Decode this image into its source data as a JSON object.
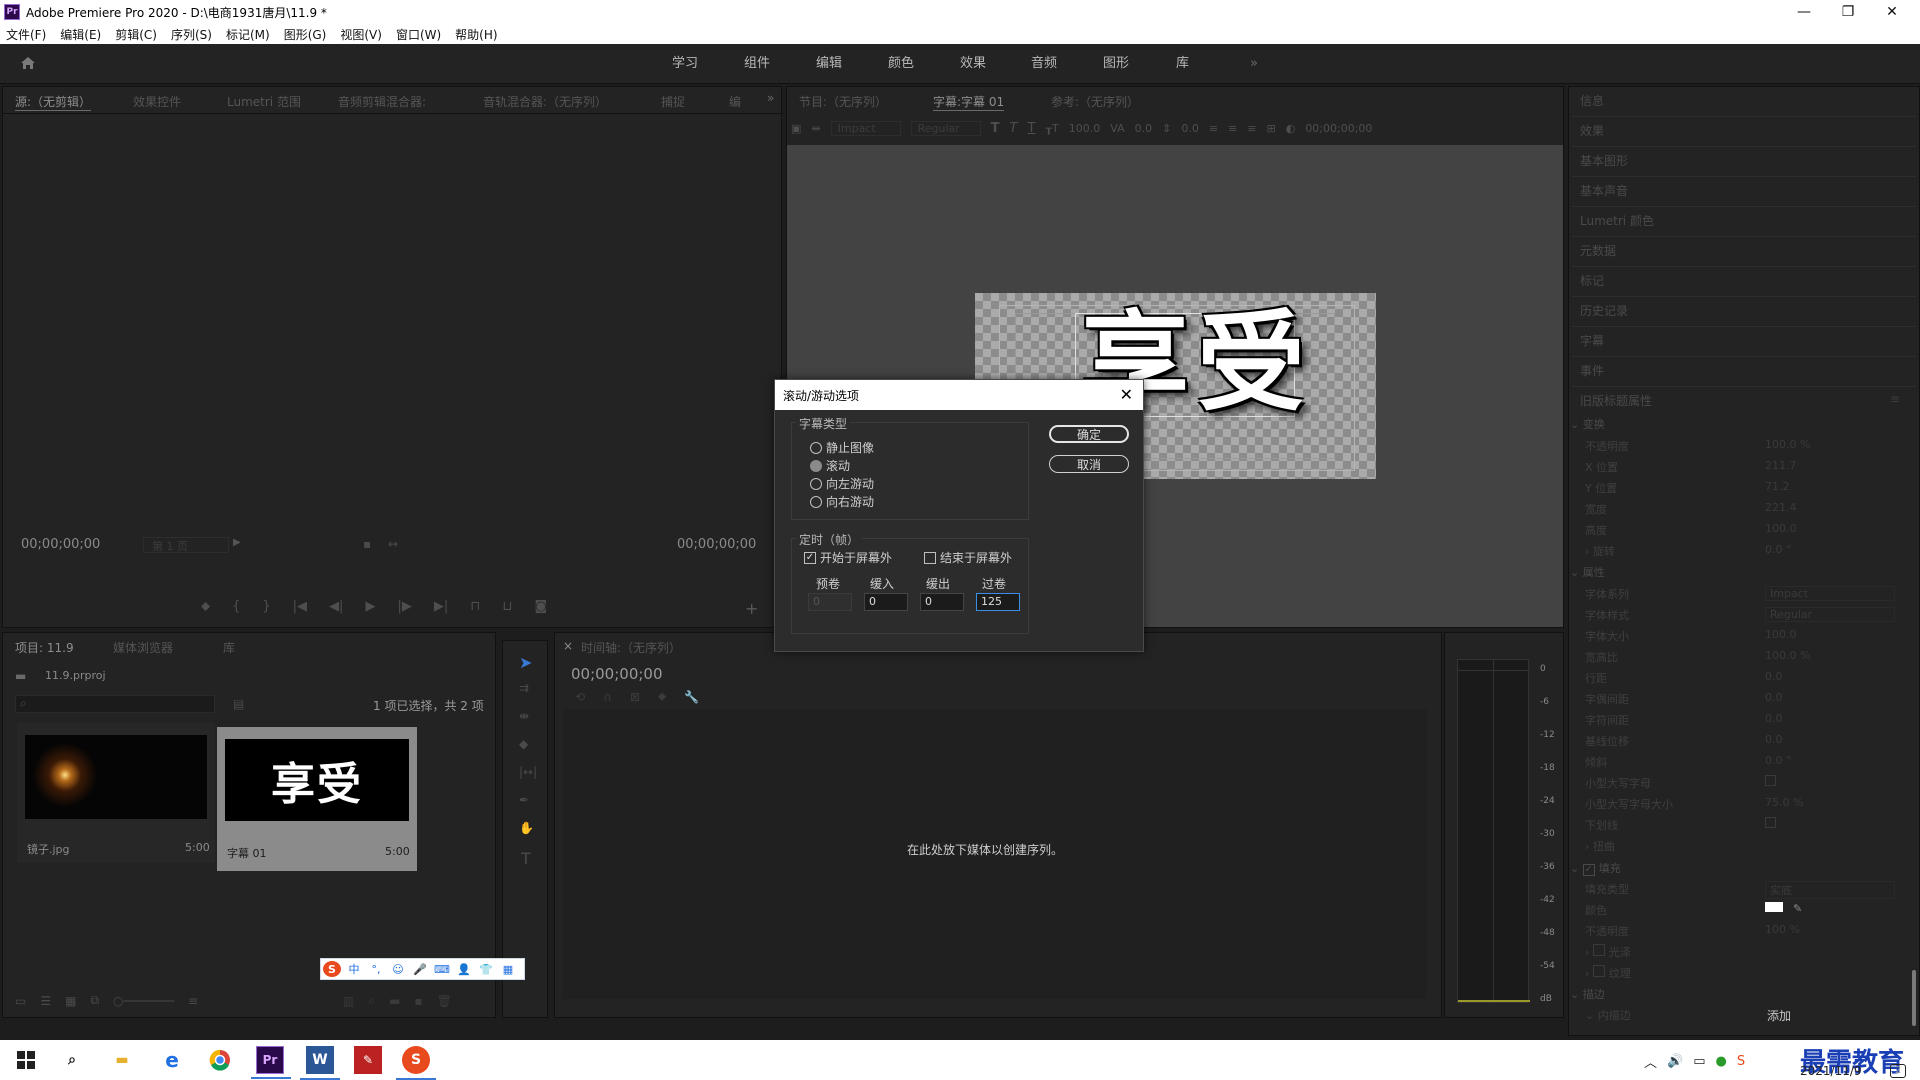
{
  "window": {
    "title": "Adobe Premiere Pro 2020 - D:\\电商1931唐月\\11.9  *",
    "app_icon": "Pr",
    "controls": [
      "minimize",
      "maximize",
      "close"
    ]
  },
  "menu": [
    "文件(F)",
    "编辑(E)",
    "剪辑(C)",
    "序列(S)",
    "标记(M)",
    "图形(G)",
    "视图(V)",
    "窗口(W)",
    "帮助(H)"
  ],
  "workspaces": {
    "tabs": [
      "学习",
      "组件",
      "编辑",
      "颜色",
      "效果",
      "音频",
      "图形",
      "库"
    ],
    "more": "»"
  },
  "source_panel": {
    "tabs": [
      "源:（无剪辑）",
      "效果控件",
      "Lumetri 范围",
      "音频剪辑混合器:",
      "音轨混合器:（无序列）",
      "捕捉",
      "编"
    ],
    "timecode_left": "00;00;00;00",
    "page": "第 1 页",
    "timecode_right": "00;00;00;00"
  },
  "program_panel": {
    "tabs": [
      "节目:（无序列）",
      "字幕:字幕 01",
      "参考:（无序列）"
    ],
    "font_family": "Impact",
    "font_style": "Regular",
    "size": "100.0",
    "kerning": "0.0",
    "leading": "0.0",
    "timecode": "00;00;00;00",
    "preview_text": "享受"
  },
  "right_panel": {
    "items": [
      "信息",
      "效果",
      "基本图形",
      "基本声音",
      "Lumetri 颜色",
      "元数据",
      "标记",
      "历史记录",
      "字幕",
      "事件"
    ],
    "section_title": "旧版标题属性",
    "transform_title": "变换",
    "transform": [
      {
        "label": "不透明度",
        "value": "100.0 %"
      },
      {
        "label": "X 位置",
        "value": "211.7"
      },
      {
        "label": "Y 位置",
        "value": "71.2"
      },
      {
        "label": "宽度",
        "value": "221.4"
      },
      {
        "label": "高度",
        "value": "100.0"
      },
      {
        "label": "旋转",
        "value": "0.0 °"
      }
    ],
    "props_title": "属性",
    "props": [
      {
        "label": "字体系列",
        "value": "Impact"
      },
      {
        "label": "字体样式",
        "value": "Regular"
      },
      {
        "label": "字体大小",
        "value": "100.0"
      },
      {
        "label": "宽高比",
        "value": "100.0 %"
      },
      {
        "label": "行距",
        "value": "0.0"
      },
      {
        "label": "字偶间距",
        "value": "0.0"
      },
      {
        "label": "字符间距",
        "value": "0.0"
      },
      {
        "label": "基线位移",
        "value": "0.0"
      },
      {
        "label": "倾斜",
        "value": "0.0 °"
      },
      {
        "label": "小型大写字母",
        "value": ""
      },
      {
        "label": "小型大写字母大小",
        "value": "75.0 %"
      },
      {
        "label": "下划线",
        "value": ""
      },
      {
        "label": "扭曲",
        "value": ""
      }
    ],
    "fill_title": "填充",
    "fill": [
      {
        "label": "填充类型",
        "value": "实底"
      },
      {
        "label": "颜色",
        "value": ""
      },
      {
        "label": "不透明度",
        "value": "100 %"
      },
      {
        "label": "光泽",
        "value": ""
      },
      {
        "label": "纹理",
        "value": ""
      }
    ],
    "stroke_title": "描边",
    "inner_stroke": "内描边",
    "add": "添加"
  },
  "project_panel": {
    "tabs": [
      "项目: 11.9",
      "媒体浏览器",
      "库"
    ],
    "file": "11.9.prproj",
    "selection": "1 项已选择，共 2 项",
    "items": [
      {
        "name": "镜子.jpg",
        "duration": "5:00"
      },
      {
        "name": "字幕 01",
        "duration": "5:00",
        "thumb_text": "享受"
      }
    ]
  },
  "timeline_panel": {
    "tab": "时间轴:（无序列）",
    "timecode": "00;00;00;00",
    "empty_hint": "在此处放下媒体以创建序列。"
  },
  "audio_meter": {
    "ticks": [
      "0",
      "-6",
      "-12",
      "-18",
      "-24",
      "-30",
      "-36",
      "-42",
      "-48",
      "-54",
      "dB"
    ]
  },
  "dialog": {
    "title": "滚动/游动选项",
    "type_group": "字幕类型",
    "types": [
      {
        "label": "静止图像",
        "selected": false
      },
      {
        "label": "滚动",
        "selected": true
      },
      {
        "label": "向左游动",
        "selected": false
      },
      {
        "label": "向右游动",
        "selected": false
      }
    ],
    "timing_group": "定时（帧）",
    "start_off": {
      "label": "开始于屏幕外",
      "checked": true
    },
    "end_off": {
      "label": "结束于屏幕外",
      "checked": false
    },
    "fields": [
      {
        "label": "预卷",
        "value": "0"
      },
      {
        "label": "缓入",
        "value": "0"
      },
      {
        "label": "缓出",
        "value": "0"
      },
      {
        "label": "过卷",
        "value": "125"
      }
    ],
    "ok": "确定",
    "cancel": "取消"
  },
  "ime": {
    "logo": "S",
    "mode": "中"
  },
  "taskbar": {
    "date": "2021/11/9",
    "watermark": "最需教育",
    "tray_badge": "2"
  }
}
